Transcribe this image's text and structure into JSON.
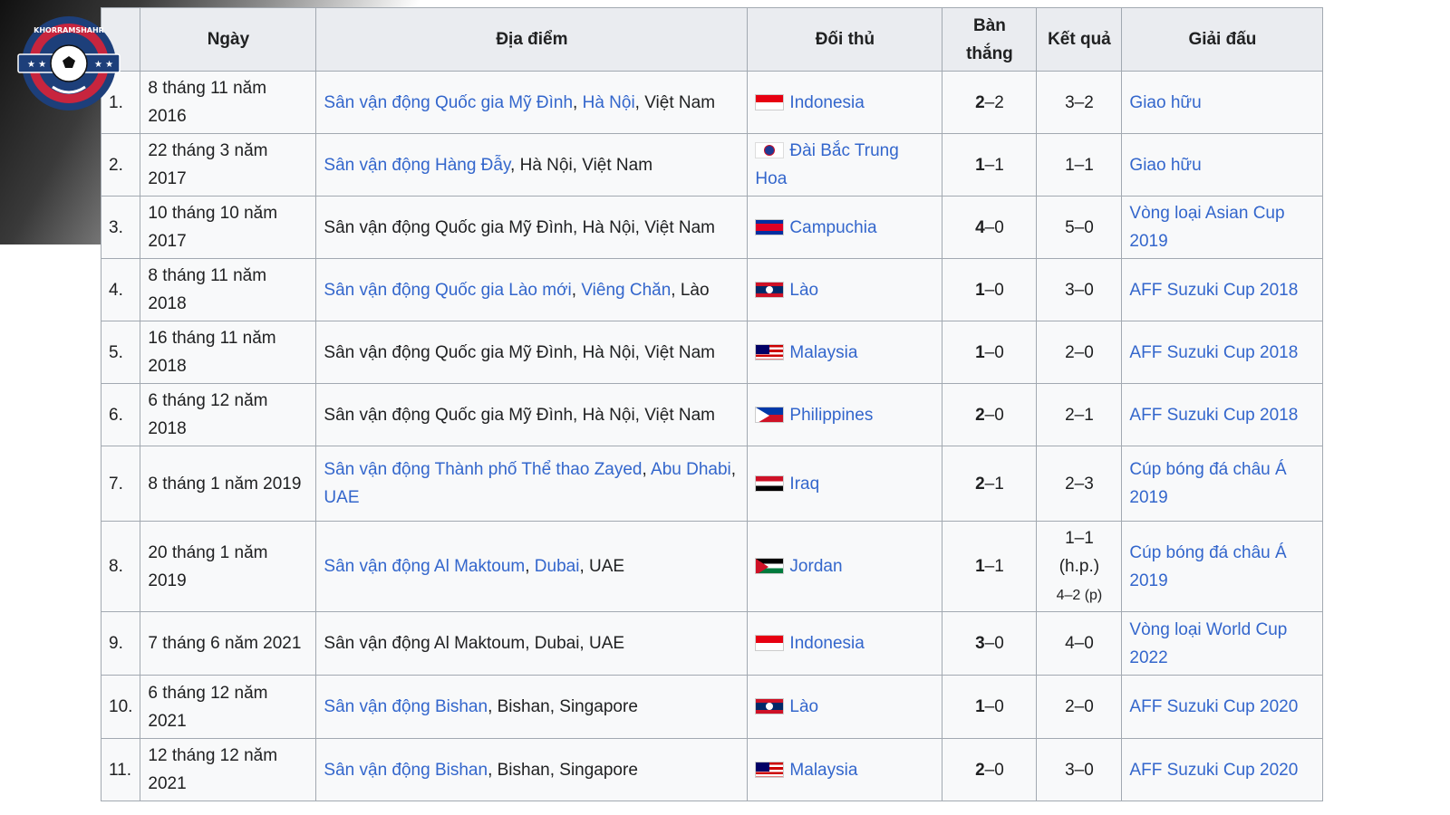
{
  "logo": {
    "text": "KHORRAMSHAHR"
  },
  "headers": {
    "num": "",
    "date": "Ngày",
    "venue": "Địa điểm",
    "opponent": "Đối thủ",
    "goal_line1": "Bàn",
    "goal_line2": "thắng",
    "result": "Kết quả",
    "competition": "Giải đấu"
  },
  "rows": [
    {
      "num": "1.",
      "date1": "8 tháng 11 năm",
      "date2": "2016",
      "venue_link1": "Sân vận động Quốc gia Mỹ Đình",
      "sep1": ", ",
      "venue_link2": "Hà Nội",
      "venue_rest": ", Việt Nam",
      "flag": "indonesia-flag",
      "opponent": "Indonesia",
      "goal": "2",
      "goal_rest": "–2",
      "result": "3–2",
      "comp1": "Giao hữu",
      "comp2": ""
    },
    {
      "num": "2.",
      "date1": "22 tháng 3 năm",
      "date2": "2017",
      "venue_link1": "Sân vận động Hàng Đẫy",
      "sep1": "",
      "venue_link2": "",
      "venue_rest": ", Hà Nội, Việt Nam",
      "flag": "chinese-taipei-flag",
      "opponent": "Đài Bắc Trung Hoa",
      "goal": "1",
      "goal_rest": "–1",
      "result": "1–1",
      "comp1": "Giao hữu",
      "comp2": ""
    },
    {
      "num": "3.",
      "date1": "10 tháng 10 năm",
      "date2": "2017",
      "venue_link1": "",
      "sep1": "",
      "venue_link2": "",
      "venue_rest": "Sân vận động Quốc gia Mỹ Đình, Hà Nội, Việt Nam",
      "flag": "cambodia-flag",
      "opponent": "Campuchia",
      "goal": "4",
      "goal_rest": "–0",
      "result": "5–0",
      "comp1": "Vòng loại Asian Cup",
      "comp2": "2019"
    },
    {
      "num": "4.",
      "date1": "8 tháng 11 năm",
      "date2": "2018",
      "venue_link1": "Sân vận động Quốc gia Lào mới",
      "sep1": ", ",
      "venue_link2": "Viêng Chăn",
      "venue_rest": ", Lào",
      "flag": "laos-flag",
      "opponent": "Lào",
      "goal": "1",
      "goal_rest": "–0",
      "result": "3–0",
      "comp1": "AFF Suzuki Cup 2018",
      "comp2": ""
    },
    {
      "num": "5.",
      "date1": "16 tháng 11 năm",
      "date2": "2018",
      "venue_link1": "",
      "sep1": "",
      "venue_link2": "",
      "venue_rest": "Sân vận động Quốc gia Mỹ Đình, Hà Nội, Việt Nam",
      "flag": "malaysia-flag",
      "opponent": "Malaysia",
      "goal": "1",
      "goal_rest": "–0",
      "result": "2–0",
      "comp1": "AFF Suzuki Cup 2018",
      "comp2": ""
    },
    {
      "num": "6.",
      "date1": "6 tháng 12 năm",
      "date2": "2018",
      "venue_link1": "",
      "sep1": "",
      "venue_link2": "",
      "venue_rest": "Sân vận động Quốc gia Mỹ Đình, Hà Nội, Việt Nam",
      "flag": "philippines-flag",
      "opponent": "Philippines",
      "goal": "2",
      "goal_rest": "–0",
      "result": "2–1",
      "comp1": "AFF Suzuki Cup 2018",
      "comp2": ""
    },
    {
      "num": "7.",
      "date1": "8 tháng 1 năm 2019",
      "date2": "",
      "venue_link1": "Sân vận động Thành phố Thể thao Zayed",
      "sep1": ", ",
      "venue_link2": "Abu Dhabi",
      "venue_rest": ",",
      "venue_line2": "UAE",
      "flag": "iraq-flag",
      "opponent": "Iraq",
      "goal": "2",
      "goal_rest": "–1",
      "result": "2–3",
      "comp1": "Cúp bóng đá châu Á",
      "comp2": "2019"
    },
    {
      "num": "8.",
      "date1": "20 tháng 1 năm",
      "date2": "2019",
      "venue_link1": "Sân vận động Al Maktoum",
      "sep1": ", ",
      "venue_link2": "Dubai",
      "venue_rest": ", UAE",
      "flag": "jordan-flag",
      "opponent": "Jordan",
      "goal": "1",
      "goal_rest": "–1",
      "result": "1–1",
      "result2": "(h.p.)",
      "result3": "4–2 (p)",
      "comp1": "Cúp bóng đá châu Á",
      "comp2": "2019"
    },
    {
      "num": "9.",
      "date1": "7 tháng 6 năm 2021",
      "date2": "",
      "venue_link1": "",
      "sep1": "",
      "venue_link2": "",
      "venue_rest": "Sân vận động Al Maktoum, Dubai, UAE",
      "flag": "indonesia-flag",
      "opponent": "Indonesia",
      "goal": "3",
      "goal_rest": "–0",
      "result": "4–0",
      "comp1": "Vòng loại World Cup",
      "comp2": "2022"
    },
    {
      "num": "10.",
      "date1": "6 tháng 12 năm",
      "date2": "2021",
      "venue_link1": "Sân vận động Bishan",
      "sep1": "",
      "venue_link2": "",
      "venue_rest": ", Bishan, Singapore",
      "flag": "laos-flag",
      "opponent": "Lào",
      "goal": "1",
      "goal_rest": "–0",
      "result": "2–0",
      "comp1": "AFF Suzuki Cup 2020",
      "comp2": ""
    },
    {
      "num": "11.",
      "date1": "12 tháng 12 năm",
      "date2": "2021",
      "venue_link1": "Sân vận động Bishan",
      "sep1": "",
      "venue_link2": "",
      "venue_rest": ", Bishan, Singapore",
      "flag": "malaysia-flag",
      "opponent": "Malaysia",
      "goal": "2",
      "goal_rest": "–0",
      "result": "3–0",
      "comp1": "AFF Suzuki Cup 2020",
      "comp2": ""
    }
  ]
}
